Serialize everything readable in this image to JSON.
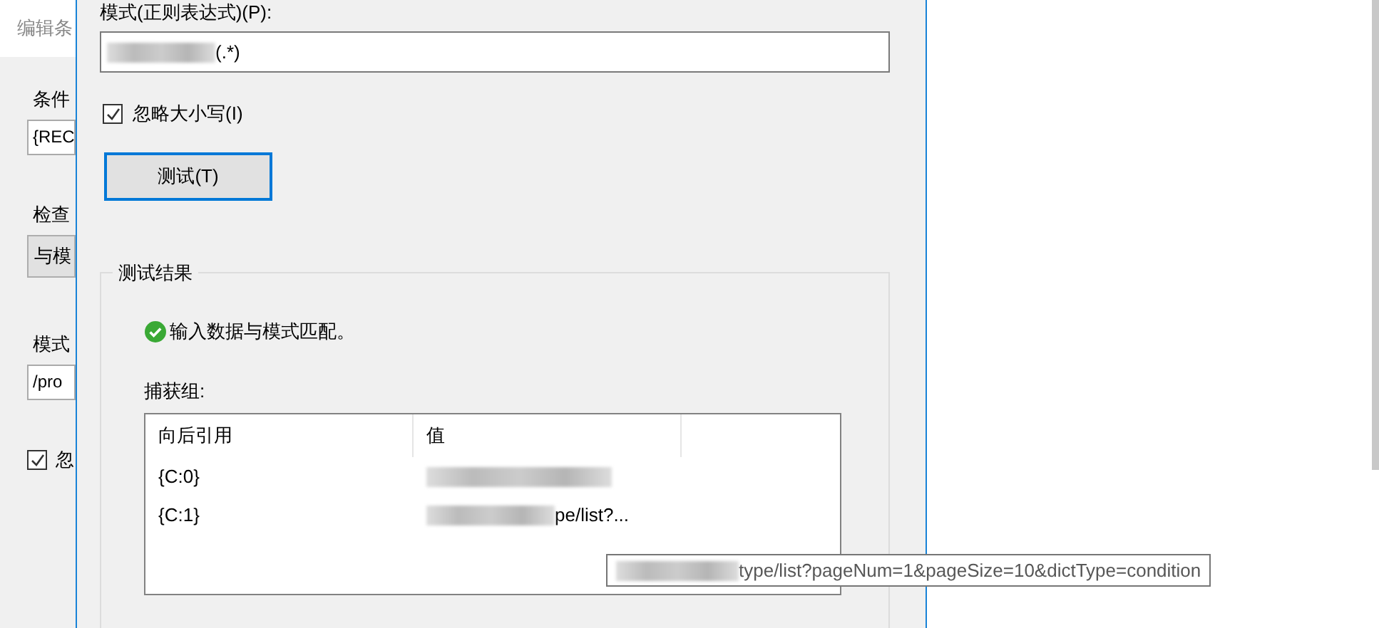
{
  "back_dialog": {
    "title": "编辑条",
    "fields": [
      {
        "kind": "field",
        "label": "条件",
        "value": "{REC"
      },
      {
        "kind": "dropdown",
        "label": "检查",
        "value": "与模"
      },
      {
        "kind": "field",
        "label": "模式",
        "value": "/pro"
      },
      {
        "kind": "checkbox",
        "label": "忽",
        "checked": true
      }
    ]
  },
  "pattern": {
    "label": "模式(正则表达式)(P):",
    "value": "(.*)",
    "redacted": true
  },
  "ignore_case": {
    "label": "忽略大小写(I)",
    "checked": true
  },
  "test_button": {
    "label": "测试(T)",
    "focused": true
  },
  "results": {
    "title": "测试结果",
    "status": {
      "kind": "success",
      "text": "输入数据与模式匹配。"
    },
    "captures_label": "捕获组:",
    "columns": [
      "向后引用",
      "值"
    ],
    "rows": [
      {
        "ref": "{C:0}",
        "value": "",
        "redacted": true
      },
      {
        "ref": "{C:1}",
        "value": "pe/list?...",
        "redacted": true
      }
    ]
  },
  "tooltip": {
    "text": "type/list?pageNum=1&pageSize=10&dictType=condition",
    "redacted": true
  }
}
